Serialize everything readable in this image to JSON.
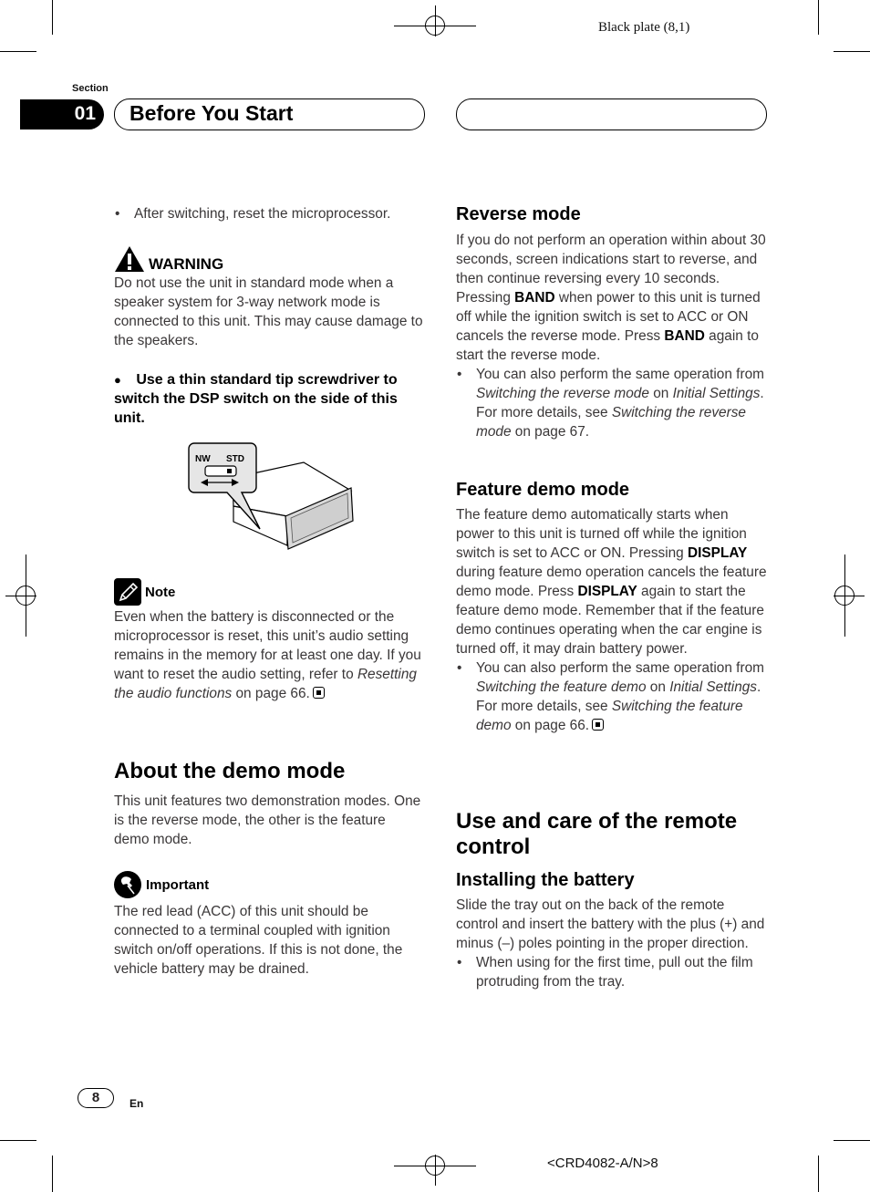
{
  "printer": {
    "plate": "Black plate (8,1)",
    "code": "<CRD4082-A/N>8"
  },
  "header": {
    "section_label": "Section",
    "section_number": "01",
    "title": "Before You Start",
    "right_title": ""
  },
  "left": {
    "bullet_reset": "After switching, reset the microprocessor.",
    "warning": {
      "icon": "warning-triangle-icon",
      "heading": "WARNING",
      "text": "Do not use the unit in standard mode when a speaker system for 3-way network mode is connected to this unit. This may cause damage to the speakers."
    },
    "step": {
      "bullet": "●",
      "text": "Use a thin standard tip screwdriver to switch the DSP switch on the side of this unit."
    },
    "illustration": {
      "label_nw": "NW",
      "label_std": "STD"
    },
    "note": {
      "icon": "pencil-icon",
      "heading": "Note",
      "text_before": "Even when the battery is disconnected or the microprocessor is reset, this unit’s audio setting remains in the memory for at least one day. If you want to reset the audio setting, refer to ",
      "link": "Resetting the audio functions",
      "text_after": " on page 66."
    },
    "demo": {
      "heading": "About the demo mode",
      "text": "This unit features two demonstration modes. One is the reverse mode, the other is the feature demo mode."
    },
    "important": {
      "icon": "pushpin-icon",
      "heading": "Important",
      "text": "The red lead (ACC) of this unit should be connected to a terminal coupled with ignition switch on/off operations. If this is not done, the vehicle battery may be drained."
    }
  },
  "right": {
    "reverse": {
      "heading": "Reverse mode",
      "p1": "If you do not perform an operation within about 30 seconds, screen indications start to reverse, and then continue reversing every 10 seconds. Pressing ",
      "key1": "BAND",
      "p2": " when power to this unit is turned off while the ignition switch is set to ACC or ON cancels the reverse mode. Press ",
      "key2": "BAND",
      "p3": " again to start the reverse mode.",
      "bullet": {
        "t1": "You can also perform the same operation from ",
        "i1": "Switching the reverse mode",
        "t2": " on ",
        "i2": "Initial Settings",
        "t3": ". For more details, see ",
        "i3": "Switching the reverse mode",
        "t4": " on page 67."
      }
    },
    "feature": {
      "heading": "Feature demo mode",
      "p1": "The feature demo automatically starts when power to this unit is turned off while the ignition switch is set to ACC or ON. Pressing ",
      "key1": "DISPLAY",
      "p2": " during feature demo operation cancels the feature demo mode. Press ",
      "key2": "DISPLAY",
      "p3": " again to start the feature demo mode. Remember that if the feature demo continues operating when the car engine is turned off, it may drain battery power.",
      "bullet": {
        "t1": "You can also perform the same operation from ",
        "i1": "Switching the feature demo",
        "t2": " on ",
        "i2": "Initial Settings",
        "t3": ". For more details, see ",
        "i3": "Switching the feature demo",
        "t4": " on page 66."
      }
    },
    "remote": {
      "heading": "Use and care of the remote control",
      "subheading": "Installing the battery",
      "text": "Slide the tray out on the back of the remote control and insert the battery with the plus (+) and minus (–) poles pointing in the proper direction.",
      "bullet": "When using for the first time, pull out the film protruding from the tray."
    }
  },
  "footer": {
    "page_number": "8",
    "language": "En"
  }
}
